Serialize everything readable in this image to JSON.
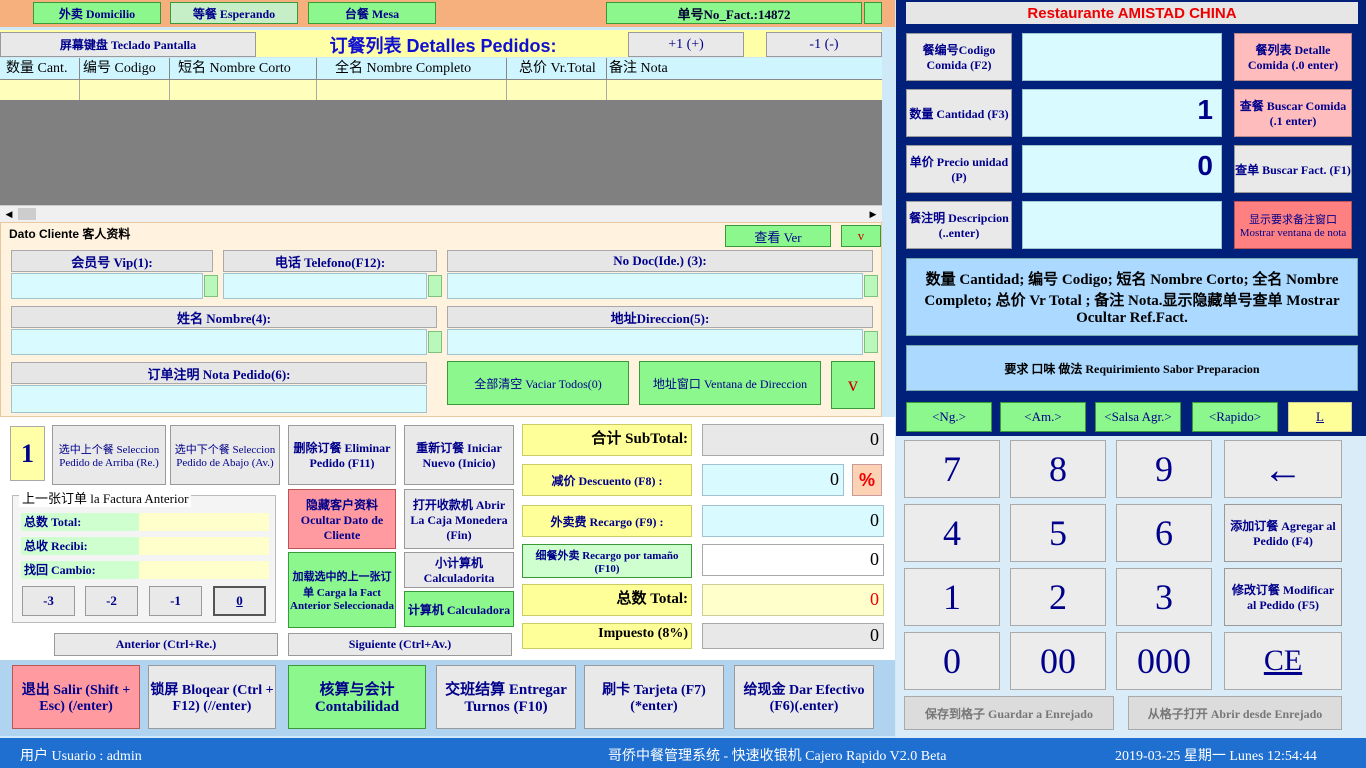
{
  "top_tabs": {
    "tab_domicilio": "外卖 Domicilio",
    "tab_esperando": "等餐 Esperando",
    "tab_mesa": "台餐 Mesa",
    "no_fact": "单号No_Fact.:14872"
  },
  "toolbar": {
    "keyboard": "屏幕键盘 Teclado Pantalla",
    "title": "订餐列表 Detalles Pedidos:",
    "plus": "+1 (+)",
    "minus": "-1 (-)"
  },
  "order_table": {
    "columns": [
      "数量 Cant.",
      "编号 Codigo",
      "短名 Nombre Corto",
      "全名 Nombre Completo",
      "总价 Vr.Total",
      "备注 Nota"
    ],
    "rows": []
  },
  "cliente": {
    "title": "Dato Cliente 客人资料",
    "ver": "查看 Ver",
    "collapse": "v",
    "vip": "会员号 Vip(1):",
    "telefono": "电话 Telefono(F12):",
    "nodoc": "No Doc(Ide.) (3):",
    "nombre": "姓名 Nombre(4):",
    "direccion": "地址Direccion(5):",
    "nota": "订单注明 Nota Pedido(6):",
    "vaciar": "全部清空 Vaciar Todos(0)",
    "ventana": "地址窗口 Ventana de Direccion",
    "expand": "v"
  },
  "selection": {
    "count": "1",
    "arriba": "选中上个餐 Seleccion Pedido de Arriba (Re.)",
    "abajo": "选中下个餐 Seleccion Pedido de Abajo (Av.)"
  },
  "anterior": {
    "legend": "上一张订单 la Factura Anterior",
    "total": "总数 Total:",
    "recibi": "总收 Recibi:",
    "cambio": "找回 Cambio:",
    "b3": "-3",
    "b2": "-2",
    "b1": "-1",
    "b0": "0"
  },
  "actions": {
    "eliminar": "删除订餐 Eliminar Pedido (F11)",
    "iniciar": "重新订餐 Iniciar Nuevo (Inicio)",
    "ocultar": "隐藏客户资料 Ocultar Dato de Cliente",
    "caja": "打开收款机 Abrir La Caja Monedera (Fin)",
    "cargar": "加载选中的上一张订单 Carga la Fact Anterior Seleccionada",
    "calc_small": "小计算机 Calculadorita",
    "calc": "计算机 Calculadora",
    "anterior": "Anterior (Ctrl+Re.)",
    "siguiente": "Siguiente (Ctrl+Av.)"
  },
  "totals": {
    "subtotal_label": "合计 SubTotal:",
    "subtotal": "0",
    "descuento_label": "减价 Descuento (F8) :",
    "descuento": "0",
    "pct": "%",
    "recargo_label": "外卖费 Recargo (F9) :",
    "recargo": "0",
    "tamano_label": "细餐外卖 Recargo por tamaño (F10)",
    "tamano": "0",
    "total_label": "总数 Total:",
    "total": "0",
    "impuesto_label": "Impuesto (8%)",
    "impuesto": "0"
  },
  "bottom": {
    "salir": "退出 Salir (Shift + Esc) (/enter)",
    "bloquear": "锁屏 Bloqear (Ctrl + F12) (//enter)",
    "contabilidad": "核算与会计 Contabilidad",
    "turnos": "交班结算 Entregar Turnos (F10)",
    "tarjeta": "刷卡 Tarjeta (F7) (*enter)",
    "efectivo": "给现金 Dar Efectivo (F6)(.enter)"
  },
  "status": {
    "usuario": "用户 Usuario : admin",
    "sistema": "哥侨中餐管理系统 - 快速收银机 Cajero Rapido V2.0 Beta",
    "fecha": "2019-03-25 星期一 Lunes 12:54:44"
  },
  "right": {
    "restaurant": "Restaurante AMISTAD CHINA",
    "codigo": "餐编号Codigo Comida (F2)",
    "codigo_val": "",
    "detalle": "餐列表 Detalle Comida (.0 enter)",
    "cantidad": "数量 Cantidad (F3)",
    "cantidad_val": "1",
    "buscar_comida": "查餐 Buscar Comida (.1 enter)",
    "precio": "单价 Precio unidad (P)",
    "precio_val": "0",
    "buscar_fact": "查单 Buscar Fact. (F1)",
    "descripcion": "餐注明 Descripcion (..enter)",
    "descripcion_val": "",
    "mostrar": "显示要求备注窗口 Mostrar ventana de nota",
    "info": "数量 Cantidad; 编号 Codigo; 短名 Nombre Corto; 全名 Nombre Completo; 总价 Vr Total ; 备注 Nota.显示隐藏单号查单 Mostrar Ocultar Ref.Fact.",
    "requerimiento": "要求 口味 做法 Requirimiento Sabor Preparacion",
    "ng": "<Ng.>",
    "am": "<Am.>",
    "salsa": "<Salsa Agr.>",
    "rapido": "<Rapido>",
    "l": "L"
  },
  "keypad": {
    "k7": "7",
    "k8": "8",
    "k9": "9",
    "back": "←",
    "k4": "4",
    "k5": "5",
    "k6": "6",
    "agregar": "添加订餐 Agregar al Pedido (F4)",
    "k1": "1",
    "k2": "2",
    "k3": "3",
    "modificar": "修改订餐 Modificar al Pedido (F5)",
    "k0": "0",
    "k00": "00",
    "k000": "000",
    "ce": "CE",
    "guardar": "保存到格子 Guardar a Enrejado",
    "abrir": "从格子打开 Abrir desde Enrejado"
  },
  "colors": {
    "navy": "#00008b",
    "panel": "#00207a",
    "lime": "#8cf78c",
    "pink": "#ff9aa0",
    "yellow": "#ffff99",
    "status": "#1e6fd0"
  }
}
